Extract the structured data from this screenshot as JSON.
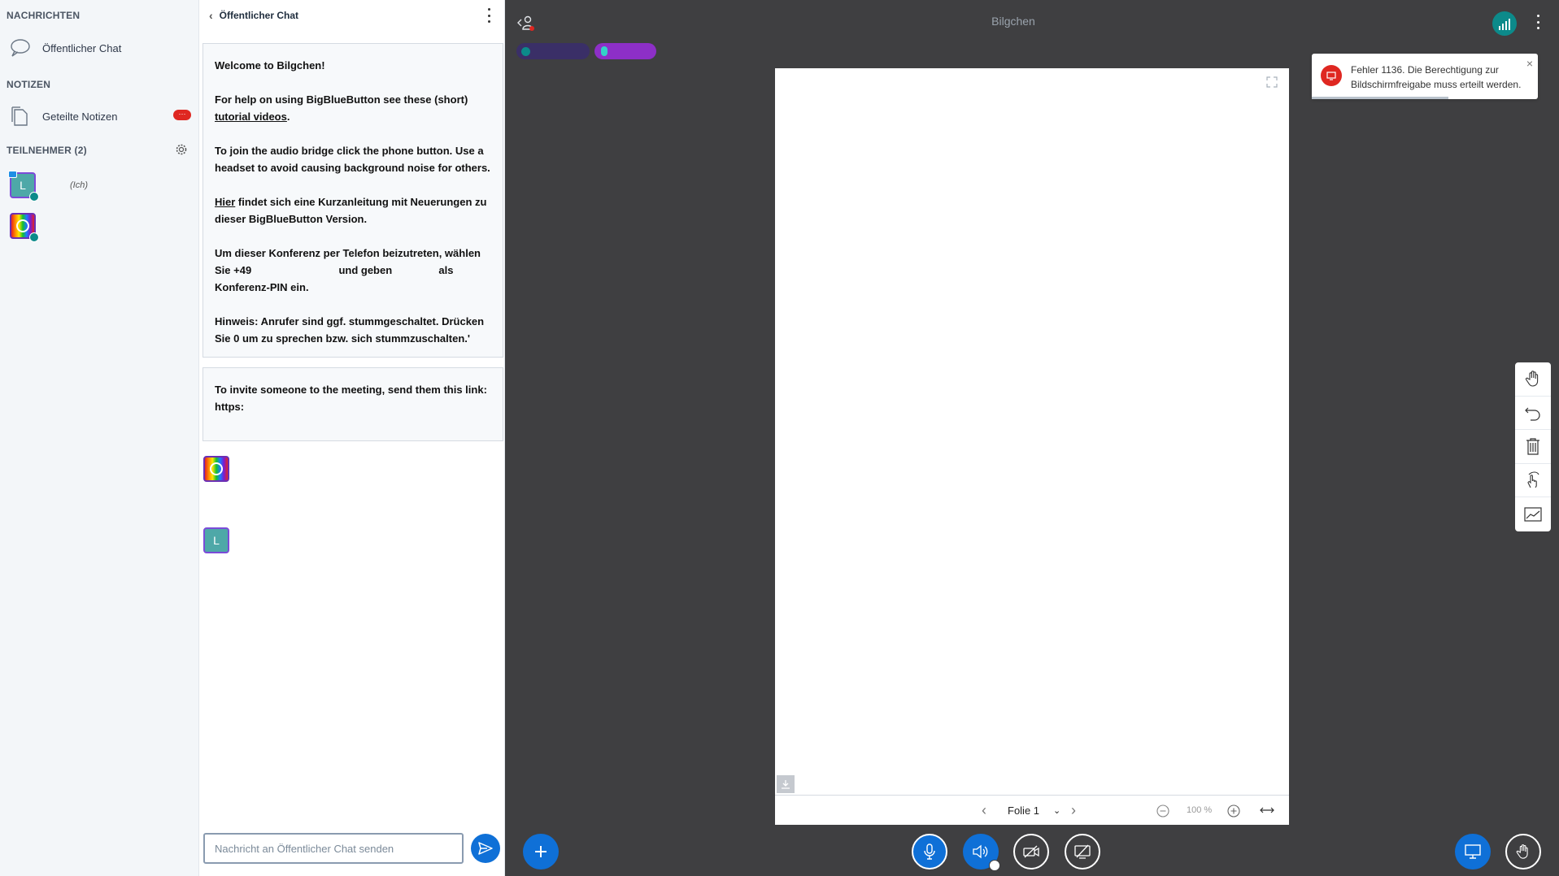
{
  "userlist": {
    "messages_title": "NACHRICHTEN",
    "public_chat_label": "Öffentlicher Chat",
    "notes_title": "NOTIZEN",
    "shared_notes_label": "Geteilte Notizen",
    "notes_badge": "···",
    "participants_title": "TEILNEHMER (2)",
    "users": [
      {
        "initial": "L",
        "tag": "(Ich)"
      },
      {
        "initial": "",
        "tag": ""
      }
    ]
  },
  "chat": {
    "title": "Öffentlicher Chat",
    "welcome": {
      "l1_a": "Welcome to ",
      "l1_b": "Bilgchen",
      "l1_c": "!",
      "l2_a": "For help on using BigBlueButton see these (short) ",
      "l2_link": "tutorial videos",
      "l2_c": ".",
      "l3": "To join the audio bridge click the phone button. Use a headset to avoid causing background noise for others.",
      "l4_link": "Hier",
      "l4_b": " findet sich eine Kurzanleitung mit Neuerungen zu dieser BigBlueButton Version.",
      "l5_a": "Um dieser Konferenz per Telefon beizutreten, wählen Sie +49",
      "l5_b": "und geben",
      "l5_c": "als Konferenz-PIN ein.",
      "l6_a": "Hinweis:",
      "l6_b": " Anrufer sind ggf. stummgeschaltet. Drücken Sie 0 um zu sprechen bzw. sich stummzuschalten.'"
    },
    "invite": {
      "l1": "To invite someone to the meeting, send them this link:",
      "l2": "https:"
    },
    "avatar_L": "L",
    "input_placeholder": "Nachricht an Öffentlicher Chat senden"
  },
  "main": {
    "presentation_title": "Bilgchen",
    "slide_label": "Folie 1",
    "zoom": "100 %",
    "toast": "Fehler 1136. Die Berechtigung zur Bildschirmfreigabe muss erteilt werden."
  },
  "colors": {
    "accent": "#0f70d7",
    "danger": "#df2721",
    "teal": "#0c8a8a",
    "purple": "#8d2fc7"
  }
}
